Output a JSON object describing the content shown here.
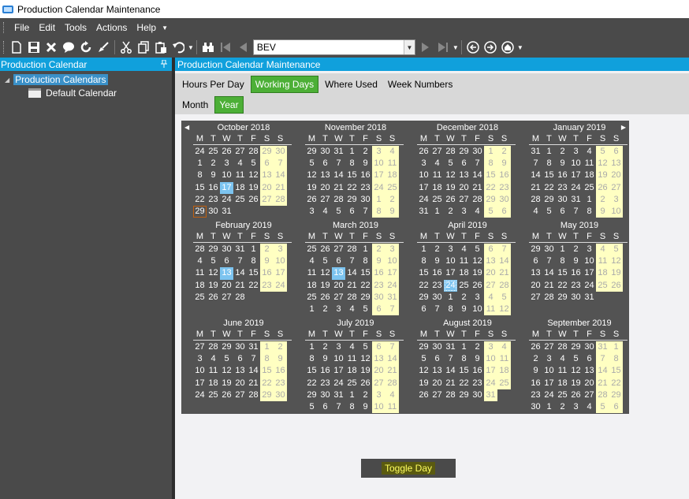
{
  "window": {
    "title": "Production Calendar Maintenance"
  },
  "menu": [
    {
      "label": "File"
    },
    {
      "label": "Edit"
    },
    {
      "label": "Tools"
    },
    {
      "label": "Actions"
    },
    {
      "label": "Help"
    }
  ],
  "toolbar": {
    "nav_value": "BEV",
    "icons": [
      "new-icon",
      "save-icon",
      "delete-icon",
      "chat-icon",
      "refresh-icon",
      "clear-icon",
      "cut-icon",
      "copy-icon",
      "paste-icon",
      "undo-icon",
      "binoculars-icon",
      "first-record-icon",
      "previous-record-icon",
      "next-record-icon",
      "last-record-icon",
      "back-icon",
      "forward-icon",
      "home-icon"
    ]
  },
  "left_pane": {
    "title": "Production Calendar",
    "tree": {
      "root": "Production Calendars",
      "child": "Default Calendar"
    }
  },
  "right_pane": {
    "title": "Production Calendar Maintenance",
    "tabs": [
      "Hours Per Day",
      "Working Days",
      "Where Used",
      "Week Numbers"
    ],
    "active_tab": "Working Days",
    "subtabs": [
      "Month",
      "Year"
    ],
    "active_subtab": "Year"
  },
  "calendar": {
    "weekday_letters": [
      "M",
      "T",
      "W",
      "T",
      "F",
      "S",
      "S"
    ],
    "months": [
      {
        "name": "October 2018",
        "lead": [
          24,
          25,
          26,
          27,
          28,
          29,
          30
        ],
        "count": 31,
        "trail": [],
        "selected": [
          17
        ],
        "today": 29,
        "extra_we": []
      },
      {
        "name": "November 2018",
        "lead": [
          29,
          30,
          31
        ],
        "count": 30,
        "trail": [
          1,
          2,
          3,
          4,
          5,
          6,
          7,
          8,
          9
        ],
        "selected": [],
        "extra_we": []
      },
      {
        "name": "December 2018",
        "lead": [
          26,
          27,
          28,
          29,
          30
        ],
        "count": 31,
        "trail": [
          1,
          2,
          3,
          4,
          5,
          6
        ],
        "selected": [],
        "extra_we": []
      },
      {
        "name": "January 2019",
        "lead": [
          31
        ],
        "count": 31,
        "trail": [
          1,
          2,
          3,
          4,
          5,
          6,
          7,
          8,
          9,
          10
        ],
        "selected": [],
        "extra_we": []
      },
      {
        "name": "February 2019",
        "lead": [
          28,
          29,
          30,
          31
        ],
        "count": 28,
        "trail": [],
        "selected": [
          13
        ],
        "extra_we": []
      },
      {
        "name": "March 2019",
        "lead": [
          25,
          26,
          27,
          28
        ],
        "count": 31,
        "trail": [
          1,
          2,
          3,
          4,
          5,
          6,
          7
        ],
        "selected": [
          13
        ],
        "extra_we": []
      },
      {
        "name": "April 2019",
        "lead": [],
        "count": 30,
        "trail": [
          1,
          2,
          3,
          4,
          5,
          6,
          7,
          8,
          9,
          10,
          11,
          12
        ],
        "selected": [],
        "focus": 24,
        "extra_we": []
      },
      {
        "name": "May 2019",
        "lead": [
          29,
          30
        ],
        "count": 31,
        "trail": [],
        "selected": [],
        "extra_we": []
      },
      {
        "name": "June 2019",
        "lead": [
          27,
          28,
          29,
          30,
          31
        ],
        "count": 30,
        "trail": [],
        "selected": [],
        "extra_we": []
      },
      {
        "name": "July 2019",
        "lead": [],
        "count": 31,
        "trail": [
          1,
          2,
          3,
          4,
          5,
          6,
          7,
          8,
          9,
          10,
          11
        ],
        "selected": [],
        "extra_we": []
      },
      {
        "name": "August 2019",
        "lead": [
          29,
          30,
          31
        ],
        "count": 31,
        "trail": [],
        "selected": [],
        "extra_we": []
      },
      {
        "name": "September 2019",
        "lead": [
          26,
          27,
          28,
          29,
          30,
          31
        ],
        "count": 30,
        "trail": [
          1,
          2,
          3,
          4,
          5,
          6
        ],
        "selected": [],
        "extra_we": []
      }
    ]
  },
  "toggle_button": {
    "label": "Toggle Day"
  }
}
